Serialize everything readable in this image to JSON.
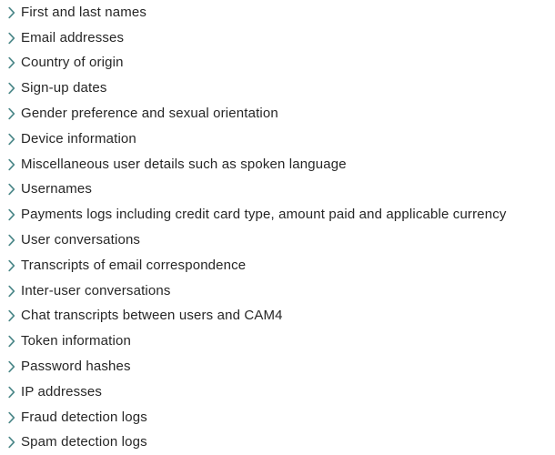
{
  "page": {
    "background_color": "#ffffff",
    "text_color": "#262626",
    "marker_color": "#4f8a8b",
    "marker_icon": "chevron-right-icon"
  },
  "list": {
    "items": [
      {
        "label": "First and last names"
      },
      {
        "label": "Email addresses"
      },
      {
        "label": "Country of origin"
      },
      {
        "label": "Sign-up dates"
      },
      {
        "label": "Gender preference and sexual orientation"
      },
      {
        "label": "Device information"
      },
      {
        "label": "Miscellaneous user details such as spoken language"
      },
      {
        "label": "Usernames"
      },
      {
        "label": "Payments logs including credit card type, amount paid and applicable currency"
      },
      {
        "label": "User conversations"
      },
      {
        "label": "Transcripts of email correspondence"
      },
      {
        "label": "Inter-user conversations"
      },
      {
        "label": "Chat transcripts between users and CAM4"
      },
      {
        "label": "Token information"
      },
      {
        "label": "Password hashes"
      },
      {
        "label": "IP addresses"
      },
      {
        "label": "Fraud detection logs"
      },
      {
        "label": "Spam detection logs"
      }
    ]
  }
}
